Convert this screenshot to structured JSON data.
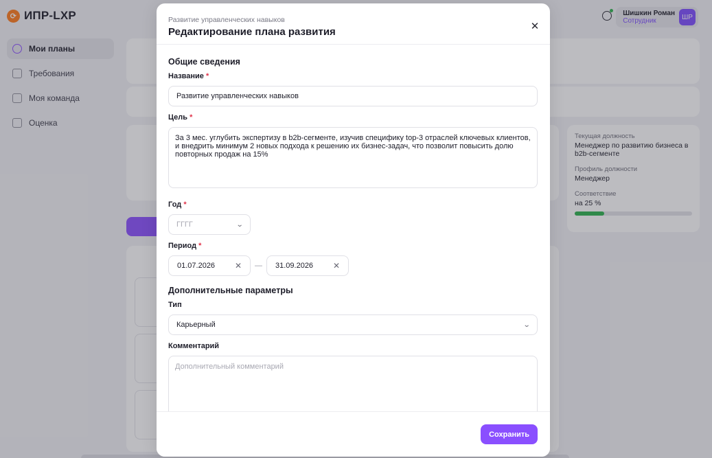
{
  "app": {
    "logo_text": "ИПР-LXP",
    "nav": [
      {
        "label": "Мои планы"
      },
      {
        "label": "Требования"
      },
      {
        "label": "Моя команда"
      },
      {
        "label": "Оценка"
      }
    ],
    "user": {
      "name": "Шишкин Роман",
      "role": "Сотрудник",
      "initials": "ШР"
    },
    "info_card": {
      "current_position_label": "Текущая должность",
      "current_position": "Менеджер по развитию бизнеса в b2b-сегменте",
      "profile_label": "Профиль должности",
      "profile": "Менеджер",
      "match_label": "Соответствие",
      "match_value": "на 25 %",
      "match_percent": 25
    },
    "accent_color": "#8a4fff"
  },
  "modal": {
    "subtitle": "Развитие управленческих навыков",
    "title": "Редактирование плана развития",
    "general_section": "Общие сведения",
    "name_label": "Название",
    "name_value": "Развитие управленческих навыков",
    "goal_label": "Цель",
    "goal_value": "За 3 мес. углубить экспертизу в b2b-сегменте, изучив специфику top-3 отраслей ключевых клиентов, и внедрить минимум 2 новых подхода к решению их бизнес-задач, что позволит повысить долю повторных продаж на 15%",
    "year_label": "Год",
    "year_placeholder": "ГГГГ",
    "period_label": "Период",
    "period_start": "01.07.2026",
    "period_end": "31.09.2026",
    "period_separator": "—",
    "extra_section": "Дополнительные параметры",
    "type_label": "Тип",
    "type_value": "Карьерный",
    "comment_label": "Комментарий",
    "comment_placeholder": "Дополнительный комментарий",
    "save_label": "Сохранить",
    "required_mark": "*"
  }
}
